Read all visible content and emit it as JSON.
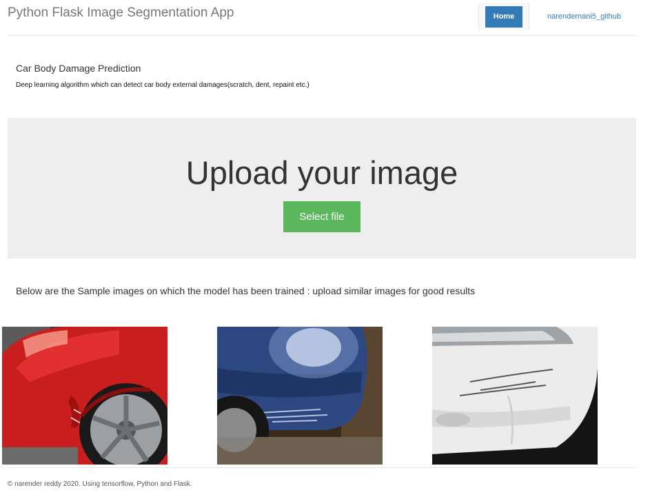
{
  "header": {
    "app_title": "Python Flask Image Segmentation App",
    "nav": {
      "home_label": "Home",
      "github_label": "narendernani5_github"
    }
  },
  "intro": {
    "title": "Car Body Damage Prediction",
    "subtitle": "Deep learning algorithm which can detect car body external damages(scratch, dent, repaint etc.)"
  },
  "upload": {
    "heading": "Upload your image",
    "select_label": "Select file"
  },
  "samples": {
    "note": "Below are the Sample images on which the model has been trained : upload similar images for good results"
  },
  "footer": {
    "text": "© narender reddy 2020. Using tensorflow, Python and Flask."
  },
  "colors": {
    "primary": "#337ab7",
    "success": "#5cb85c",
    "jumbotron_bg": "#eeeeee"
  }
}
